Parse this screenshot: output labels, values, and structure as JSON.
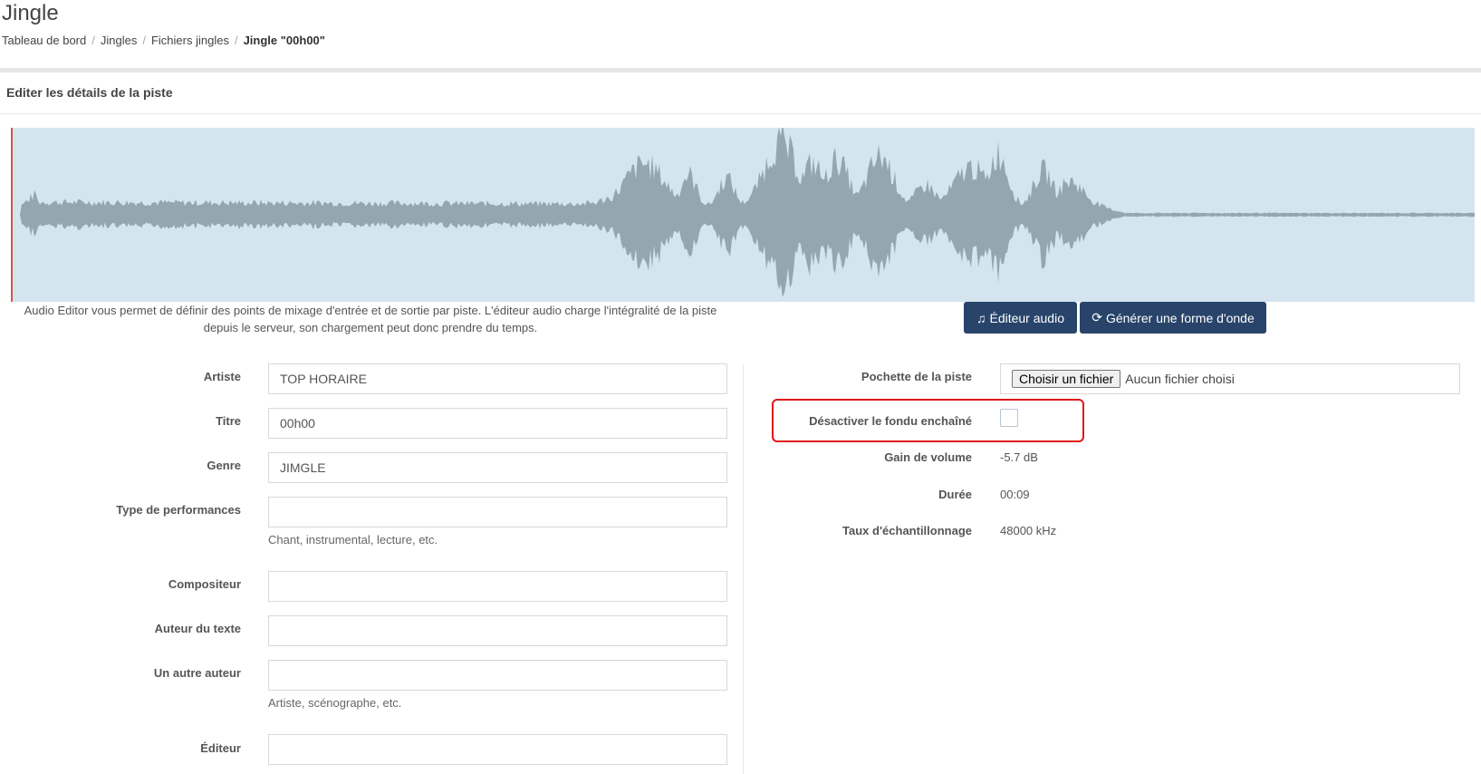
{
  "header": {
    "title": "Jingle",
    "breadcrumb": [
      "Tableau de bord",
      "Jingles",
      "Fichiers jingles",
      "Jingle \"00h00\""
    ]
  },
  "panel": {
    "title": "Editer les détails de la piste"
  },
  "editor": {
    "help": "Audio Editor vous permet de définir des points de mixage d'entrée et de sortie par piste. L'éditeur audio charge l'intégralité de la piste depuis le serveur, son chargement peut donc prendre du temps.",
    "audio_editor_label": "Éditeur audio",
    "waveform_label": "Générer une forme d'onde"
  },
  "form": {
    "artist": {
      "label": "Artiste",
      "value": "TOP HORAIRE"
    },
    "title": {
      "label": "Titre",
      "value": "00h00"
    },
    "genre": {
      "label": "Genre",
      "value": "JIMGLE"
    },
    "performance_type": {
      "label": "Type de performances",
      "value": "",
      "help": "Chant, instrumental, lecture, etc."
    },
    "composer": {
      "label": "Compositeur",
      "value": ""
    },
    "lyricist": {
      "label": "Auteur du texte",
      "value": ""
    },
    "other_author": {
      "label": "Un autre auteur",
      "value": "",
      "help": "Artiste, scénographe, etc."
    },
    "publisher": {
      "label": "Éditeur",
      "value": ""
    }
  },
  "details": {
    "artwork": {
      "label": "Pochette de la piste",
      "button": "Choisir un fichier",
      "status": "Aucun fichier choisi"
    },
    "disable_crossfade": {
      "label": "Désactiver le fondu enchaîné",
      "checked": false
    },
    "volume_gain": {
      "label": "Gain de volume",
      "value": "-5.7 dB"
    },
    "duration": {
      "label": "Durée",
      "value": "00:09"
    },
    "sample_rate": {
      "label": "Taux d'échantillonnage",
      "value": "48000 kHz"
    }
  },
  "colors": {
    "waveform_bg": "#d4e5f0",
    "waveform_fill": "#96a6b0",
    "playhead": "#d9534f",
    "button_bg": "#28446a",
    "highlight": "#e0151b"
  }
}
